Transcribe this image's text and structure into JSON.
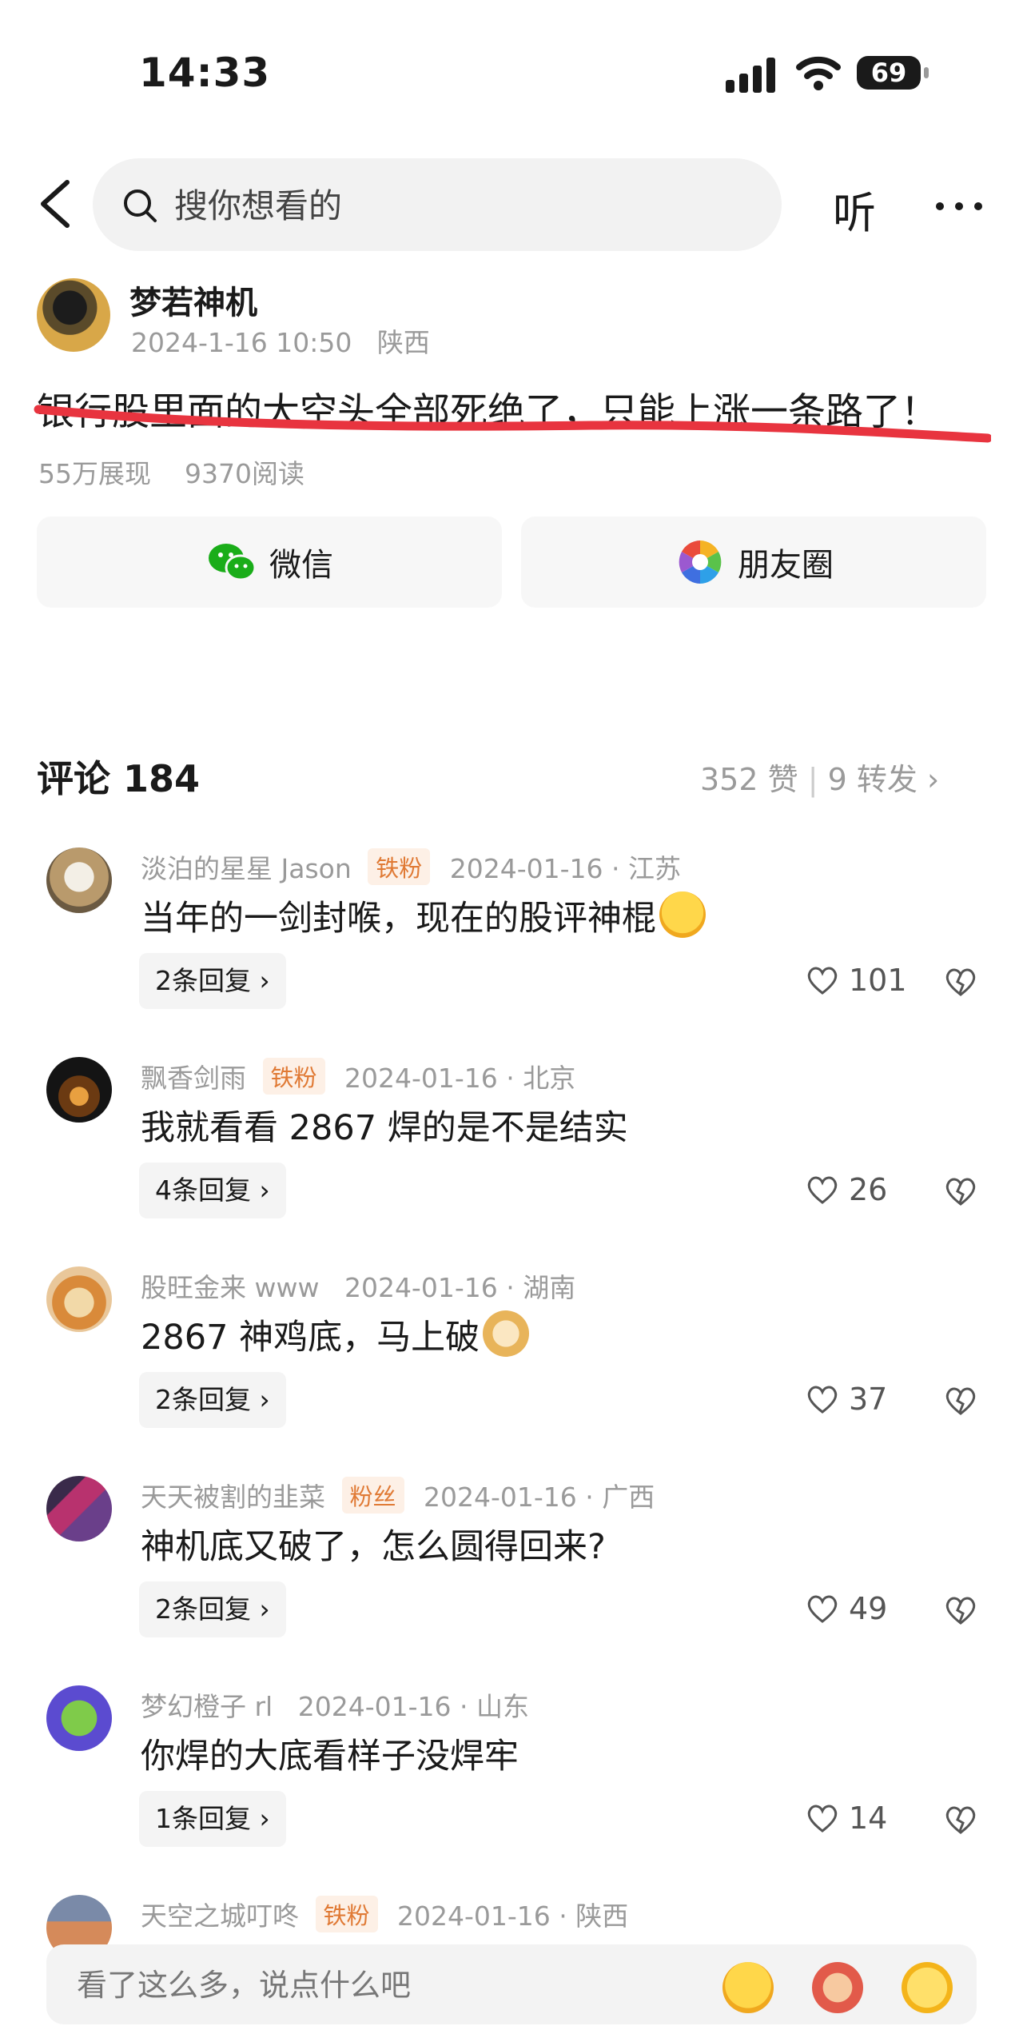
{
  "status_bar": {
    "time": "14:33",
    "battery": "69"
  },
  "nav": {
    "search_placeholder": "搜你想看的",
    "listen_label": "听"
  },
  "post": {
    "author": "梦若神机",
    "date": "2024-1-16 10:50",
    "location": "陕西",
    "title": "银行股里面的大空头全部死绝了，只能上涨一条路了！",
    "impressions": "55万展现",
    "reads": "9370阅读"
  },
  "share": {
    "wechat_label": "微信",
    "moments_label": "朋友圈"
  },
  "comments_header": {
    "title": "评论 184",
    "likes": "352 赞",
    "shares": "9 转发"
  },
  "comments": [
    {
      "user": "淡泊的星星 Jason",
      "badge": "铁粉",
      "date": "2024-01-16 · 江苏",
      "text": "当年的一剑封喉，现在的股评神棍",
      "emoji": "rolling-laughing-emoji",
      "replies": "2条回复",
      "likes": "101"
    },
    {
      "user": "飘香剑雨",
      "badge": "铁粉",
      "date": "2024-01-16 · 北京",
      "text": "我就看看 2867 焊的是不是结实",
      "emoji": "",
      "replies": "4条回复",
      "likes": "26"
    },
    {
      "user": "股旺金来 www",
      "badge": "",
      "date": "2024-01-16 · 湖南",
      "text": "2867 神鸡底，马上破",
      "emoji": "doge-emoji",
      "replies": "2条回复",
      "likes": "37"
    },
    {
      "user": "天天被割的韭菜",
      "badge": "粉丝",
      "date": "2024-01-16 · 广西",
      "text": "神机底又破了，怎么圆得回来?",
      "emoji": "",
      "replies": "2条回复",
      "likes": "49"
    },
    {
      "user": "梦幻橙子 rl",
      "badge": "",
      "date": "2024-01-16 · 山东",
      "text": "你焊的大底看样子没焊牢",
      "emoji": "",
      "replies": "1条回复",
      "likes": "14"
    },
    {
      "user": "天空之城叮咚",
      "badge": "铁粉",
      "date": "2024-01-16 · 陕西",
      "text": "",
      "emoji": "",
      "replies": "",
      "likes": ""
    }
  ],
  "bottom": {
    "input_placeholder": "看了这么多，说点什么吧"
  },
  "colors": {
    "accent_red": "#e8343f",
    "wechat_green": "#1aad19",
    "badge_bg": "#fdf0e6",
    "badge_text": "#e07a35"
  }
}
